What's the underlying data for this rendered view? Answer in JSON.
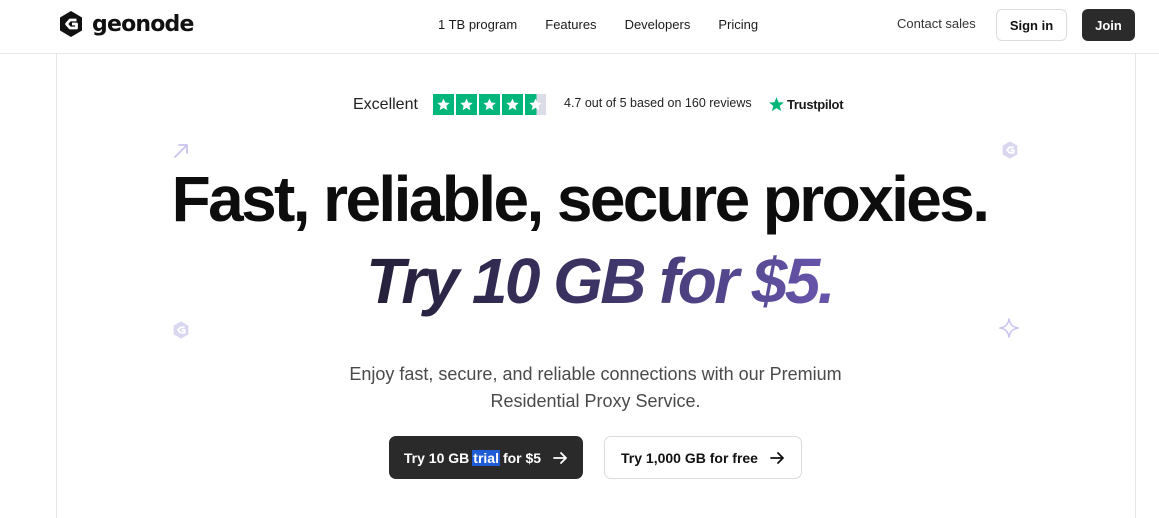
{
  "brand": {
    "name": "geonode"
  },
  "nav": {
    "items": [
      {
        "label": "1 TB program"
      },
      {
        "label": "Features"
      },
      {
        "label": "Developers"
      },
      {
        "label": "Pricing"
      }
    ]
  },
  "header_actions": {
    "contact": "Contact sales",
    "signin": "Sign in",
    "join": "Join"
  },
  "trustpilot": {
    "excellent": "Excellent",
    "rating_text": "4.7 out of 5 based on 160 reviews",
    "brand": "Trustpilot",
    "stars": 4.5,
    "star_color": "#00b67a"
  },
  "hero": {
    "headline": "Fast, reliable, secure proxies.",
    "subheadline": "Try 10 GB for $5.",
    "subtext_line1": "Enjoy fast, secure, and reliable connections with our Premium",
    "subtext_line2": "Residential Proxy Service.",
    "primary_button": {
      "before": "Try 10 GB",
      "highlight": "trial",
      "after": "for $5"
    },
    "secondary_button": "Try 1,000 GB for free"
  },
  "colors": {
    "accent_purple": "#6856ad",
    "dark_button": "#2a2a2a",
    "selection": "#1f5bd6",
    "decor": "#c9c4ee"
  },
  "icons": [
    "geonode-logo-icon",
    "star-icon",
    "trustpilot-star-icon",
    "arrow-right-icon",
    "diagonal-arrow-icon",
    "sparkle-icon",
    "geonode-mark-icon"
  ]
}
